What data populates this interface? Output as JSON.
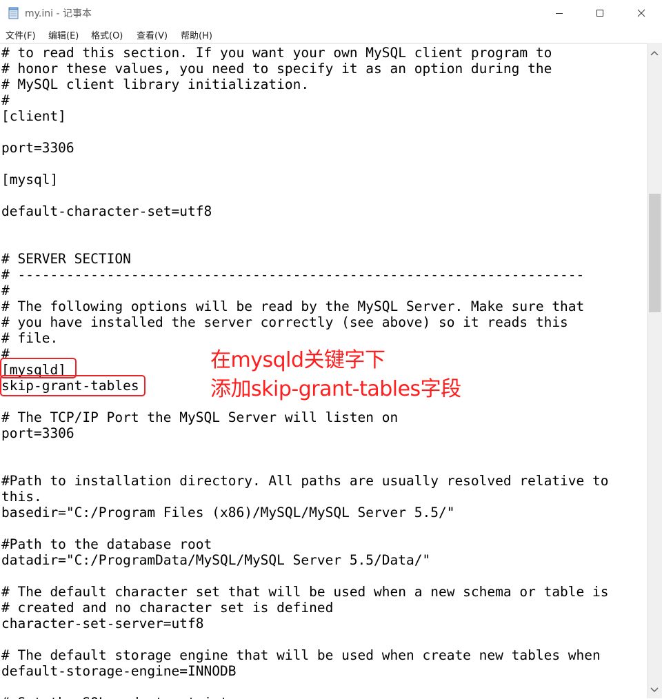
{
  "window": {
    "title": "my.ini - 记事本",
    "icons": {
      "app": "notepad-icon",
      "minimize": "minimize-icon",
      "maximize": "maximize-icon",
      "close": "close-icon"
    }
  },
  "menu": [
    {
      "label": "文件(F)"
    },
    {
      "label": "编辑(E)"
    },
    {
      "label": "格式(O)"
    },
    {
      "label": "查看(V)"
    },
    {
      "label": "帮助(H)"
    }
  ],
  "editor_lines": [
    "# to read this section. If you want your own MySQL client program to",
    "# honor these values, you need to specify it as an option during the",
    "# MySQL client library initialization.",
    "#",
    "[client]",
    "",
    "port=3306",
    "",
    "[mysql]",
    "",
    "default-character-set=utf8",
    "",
    "",
    "# SERVER SECTION",
    "# ----------------------------------------------------------------------",
    "#",
    "# The following options will be read by the MySQL Server. Make sure that",
    "# you have installed the server correctly (see above) so it reads this",
    "# file.",
    "#",
    "[mysqld]",
    "skip-grant-tables",
    "",
    "# The TCP/IP Port the MySQL Server will listen on",
    "port=3306",
    "",
    "",
    "#Path to installation directory. All paths are usually resolved relative to",
    "this.",
    "basedir=\"C:/Program Files (x86)/MySQL/MySQL Server 5.5/\"",
    "",
    "#Path to the database root",
    "datadir=\"C:/ProgramData/MySQL/MySQL Server 5.5/Data/\"",
    "",
    "# The default character set that will be used when a new schema or table is",
    "# created and no character set is defined",
    "character-set-server=utf8",
    "",
    "# The default storage engine that will be used when create new tables when",
    "default-storage-engine=INNODB",
    "",
    "# Set the SQL mode to strict"
  ],
  "annotation": {
    "line1": "在mysqld关键字下",
    "line2": "添加skip-grant-tables字段",
    "color": "#ff1e1e"
  },
  "scrollbar": {
    "up_icon": "scroll-up-arrow-icon",
    "down_icon": "scroll-down-arrow-icon"
  }
}
